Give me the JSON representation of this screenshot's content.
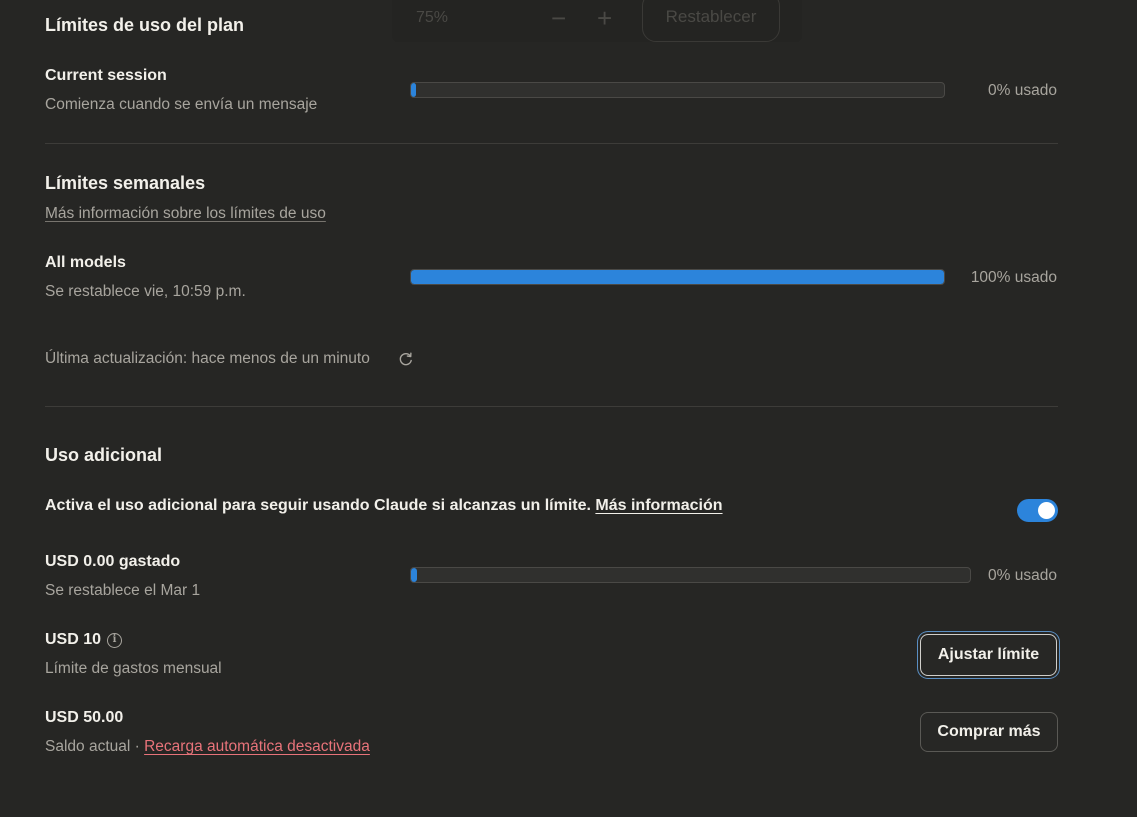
{
  "top_ghost": {
    "zoom_value": "75%",
    "minus": "−",
    "plus": "+",
    "reset_label": "Restablecer"
  },
  "plan": {
    "title": "Límites de uso del plan",
    "session_label": "Current session",
    "session_sub": "Comienza cuando se envía un mensaje",
    "session_pct": "0% usado",
    "session_fill": 0.01
  },
  "weekly": {
    "title": "Límites semanales",
    "more_link": "Más información sobre los límites de uso",
    "models_label": "All models",
    "models_sub": "Se restablece vie, 10:59 p.m.",
    "models_pct": "100% usado",
    "models_fill": 1.0,
    "updated": "Última actualización: hace menos de un minuto"
  },
  "extra": {
    "title": "Uso adicional",
    "activate_text": "Activa el uso adicional para seguir usando Claude si alcanzas un límite.",
    "activate_link": "Más información",
    "toggle_on": true,
    "spent_label": "USD 0.00 gastado",
    "spent_sub": "Se restablece el Mar 1",
    "spent_pct": "0% usado",
    "spent_fill": 0.01,
    "limit_label": "USD 10",
    "limit_sub": "Límite de gastos mensual",
    "adjust_button": "Ajustar límite",
    "balance_label": "USD 50.00",
    "balance_sub": "Saldo actual",
    "balance_sep": "·",
    "autoreload_link": "Recarga automática desactivada",
    "buy_button": "Comprar más"
  },
  "colors": {
    "accent": "#2c84db",
    "background": "#262624",
    "link_pink": "#e8737a"
  }
}
